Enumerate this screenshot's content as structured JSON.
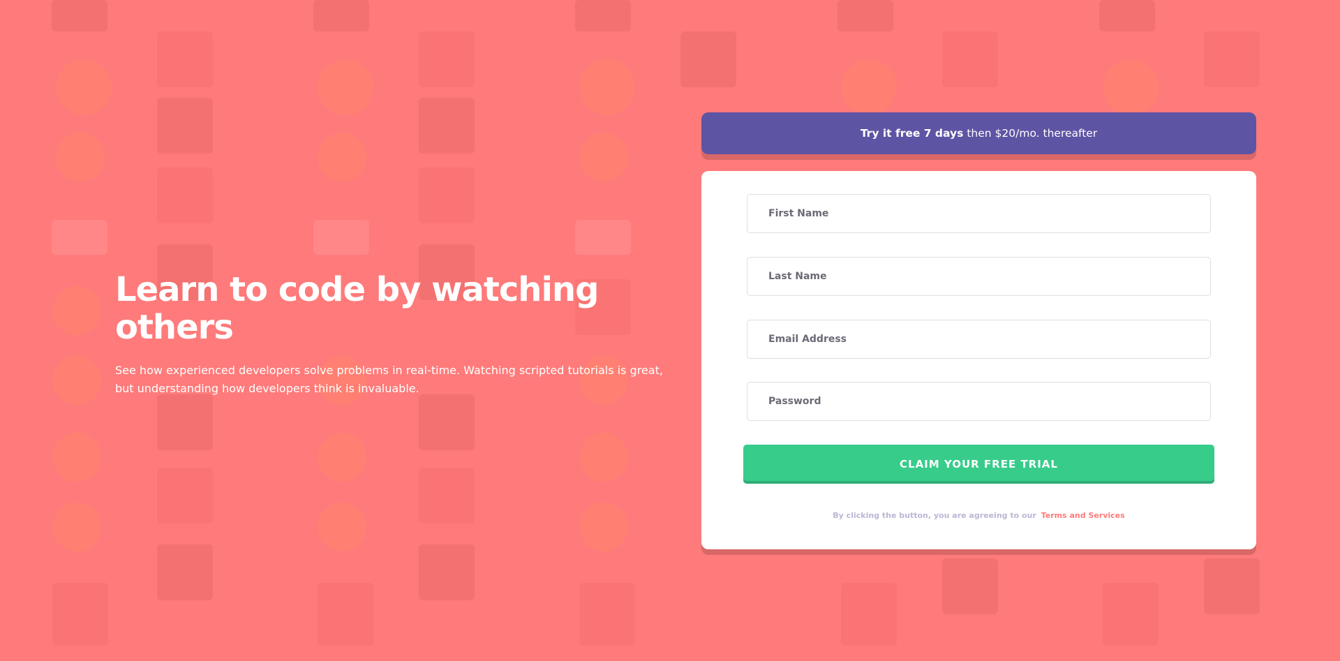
{
  "hero": {
    "title": "Learn to code by watching others",
    "description": "See how experienced developers solve problems in real-time. Watching scripted tutorials is great, but understanding how developers think is invaluable."
  },
  "promo": {
    "bold_text": "Try it free 7 days",
    "rest_text": "then $20/mo. thereafter",
    "background": "#5e54a4"
  },
  "form": {
    "first_name_placeholder": "First Name",
    "last_name_placeholder": "Last Name",
    "email_placeholder": "Email Address",
    "password_placeholder": "Password",
    "submit_label": "CLAIM YOUR FREE TRIAL",
    "submit_color": "#38cc8b",
    "terms_text": "By clicking the button, you are agreeing to our",
    "terms_link": "Terms and Services"
  },
  "theme": {
    "background": "#ff7a7a",
    "accent": "#ff7a7a"
  }
}
